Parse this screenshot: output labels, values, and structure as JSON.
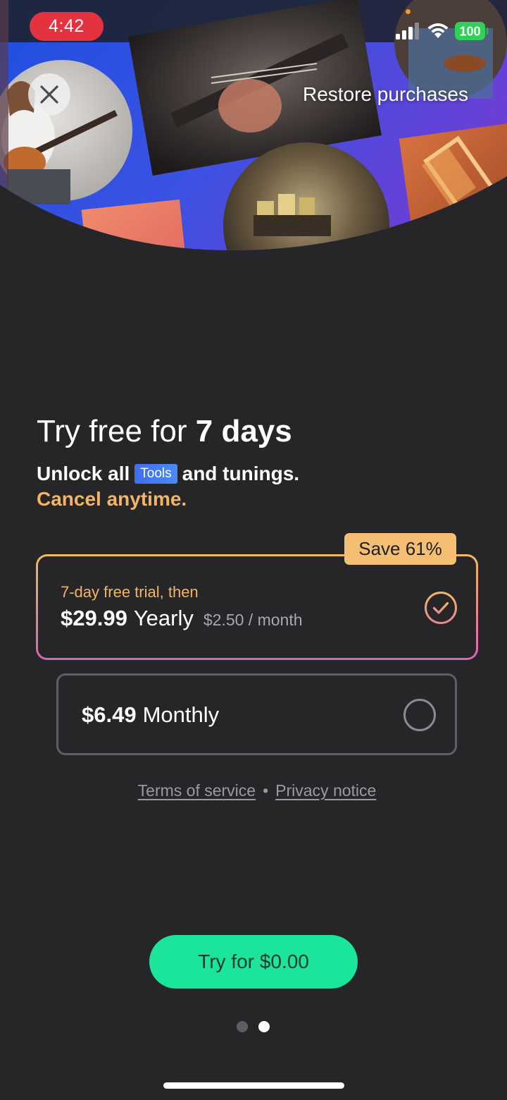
{
  "status_bar": {
    "time": "4:42",
    "battery": "100",
    "battery_color": "#30d158"
  },
  "header": {
    "restore_label": "Restore purchases"
  },
  "promo": {
    "headline_prefix": "Try free for ",
    "headline_bold": "7 days",
    "unlock_prefix": "Unlock all",
    "tools_badge": "Tools",
    "unlock_suffix": "and tunings.",
    "cancel_text": "Cancel anytime."
  },
  "plans": {
    "yearly": {
      "badge": "Save 61%",
      "trial_text": "7-day free trial, then",
      "price": "$29.99",
      "period": "Yearly",
      "per_month": "$2.50 / month",
      "selected": true
    },
    "monthly": {
      "price": "$6.49",
      "period": "Monthly",
      "selected": false
    }
  },
  "legal": {
    "terms": "Terms of service",
    "separator": "•",
    "privacy": "Privacy notice"
  },
  "cta": {
    "label": "Try for $0.00"
  },
  "pagination": {
    "total": 2,
    "current": 2
  },
  "colors": {
    "background": "#262629",
    "accent_gold": "#f2b565",
    "cta_green": "#1be59a",
    "tools_blue": "#3f6ef0"
  }
}
